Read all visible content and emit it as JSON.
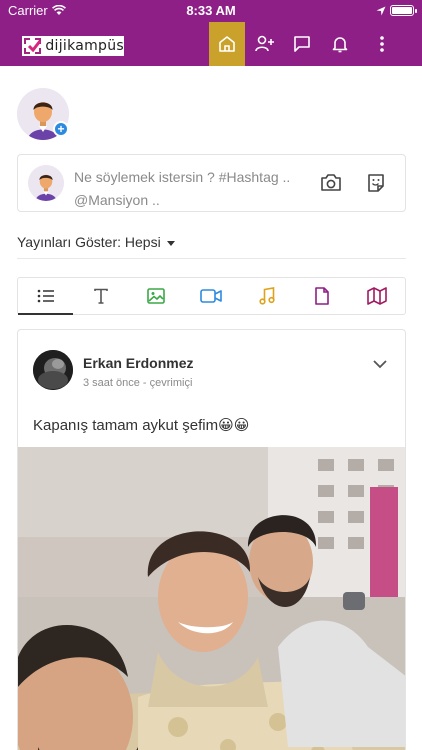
{
  "status_bar": {
    "carrier": "Carrier",
    "time": "8:33 AM"
  },
  "nav": {
    "logo_text": "dijikampüs",
    "icons": [
      "home-icon",
      "add-user-icon",
      "message-icon",
      "bell-icon",
      "more-vertical-icon"
    ],
    "active": "home-icon",
    "accent_color": "#8e1f86",
    "active_color": "#c9a12b"
  },
  "composer": {
    "line1": "Ne söylemek istersin ? #Hashtag ..",
    "line2": "@Mansiyon .."
  },
  "filter": {
    "label": "Yayınları Göster:",
    "value": "Hepsi"
  },
  "tabs": [
    {
      "icon": "list-icon",
      "color": "#333333",
      "active": true
    },
    {
      "icon": "text-icon",
      "color": "#555555",
      "active": false
    },
    {
      "icon": "image-icon",
      "color": "#3aa845",
      "active": false
    },
    {
      "icon": "video-icon",
      "color": "#2c8be0",
      "active": false
    },
    {
      "icon": "music-icon",
      "color": "#e0a21b",
      "active": false
    },
    {
      "icon": "file-icon",
      "color": "#8e1f86",
      "active": false
    },
    {
      "icon": "map-icon",
      "color": "#a01b62",
      "active": false
    }
  ],
  "post": {
    "author": "Erkan Erdonmez",
    "meta": "3 saat önce - çevrimiçi",
    "text": "Kapanış tamam aykut şefim😀😀"
  }
}
